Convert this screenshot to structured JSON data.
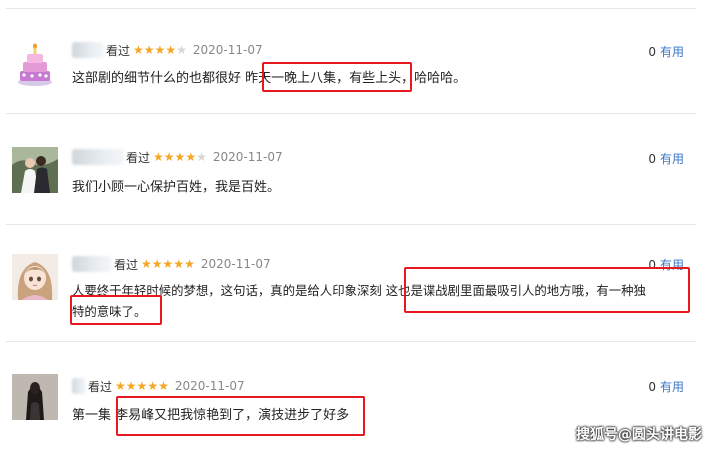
{
  "reviews": [
    {
      "seen_label": "看过",
      "rating": 4,
      "date": "2020-11-07",
      "useful_count": "0",
      "useful_label": "有用",
      "text_line1": "这部剧的细节什么的也都很好 昨天一晚上八集，有些上头，哈哈哈。",
      "avatar": "cake-icon"
    },
    {
      "seen_label": "看过",
      "rating": 4,
      "date": "2020-11-07",
      "useful_count": "0",
      "useful_label": "有用",
      "text_line1": "我们小顾一心保护百姓，我是百姓。",
      "avatar": "couple-photo"
    },
    {
      "seen_label": "看过",
      "rating": 5,
      "date": "2020-11-07",
      "useful_count": "0",
      "useful_label": "有用",
      "text_line1": "人要终于年轻时候的梦想，这句话，真的是给人印象深刻 这也是谍战剧里面最吸引人的地方哦，有一种独",
      "text_line2": "特的意味了。",
      "avatar": "anime-girl-avatar"
    },
    {
      "seen_label": "看过",
      "rating": 5,
      "date": "2020-11-07",
      "useful_count": "0",
      "useful_label": "有用",
      "text_line1": "第一集  李易峰又把我惊艳到了，演技进步了好多",
      "avatar": "woman-photo"
    }
  ],
  "watermark": "搜狐号@圆头讲电影",
  "colors": {
    "star": "#f5a623",
    "link": "#3a77c6",
    "highlight": "#e5191f"
  }
}
